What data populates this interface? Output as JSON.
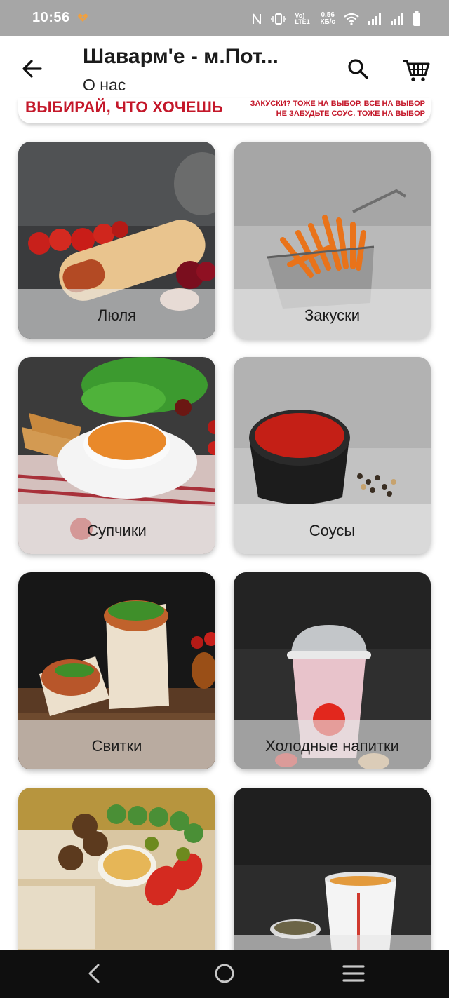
{
  "status_bar": {
    "time": "10:56",
    "lte": "Vo) LTE1",
    "speed_value": "0,56",
    "speed_unit": "КБ/с",
    "icons": [
      "heart-icon",
      "nfc-icon",
      "vibrate-icon",
      "wifi-icon",
      "signal-icon",
      "signal-icon",
      "battery-icon"
    ]
  },
  "header": {
    "title": "Шаварм'е - м.Пот...",
    "subtitle": "О нас",
    "back_icon": "arrow-left-icon",
    "search_icon": "search-icon",
    "cart_icon": "cart-icon"
  },
  "banner": {
    "left_text": "ВЫБИРАЙ, ЧТО ХОЧЕШЬ",
    "right_line1": "ЗАКУСКИ? ТОЖЕ НА ВЫБОР. ВСЕ НА ВЫБОР",
    "right_line2": "НЕ ЗАБУДЬТЕ СОУС. ТОЖЕ НА ВЫБОР",
    "text_color": "#c4182a"
  },
  "categories": [
    {
      "label": "Люля",
      "image": "shawarma-roll-image"
    },
    {
      "label": "Закуски",
      "image": "fries-basket-image"
    },
    {
      "label": "Супчики",
      "image": "soup-bowl-image"
    },
    {
      "label": "Соусы",
      "image": "sauce-bowl-image"
    },
    {
      "label": "Свитки",
      "image": "wraps-image"
    },
    {
      "label": "Холодные напитки",
      "image": "milkshake-cup-image"
    },
    {
      "label": "",
      "image": "platter-image"
    },
    {
      "label": "",
      "image": "hot-drink-cup-image"
    }
  ],
  "nav_bar": {
    "icons": [
      "back-nav-icon",
      "home-nav-icon",
      "menu-nav-icon"
    ]
  }
}
